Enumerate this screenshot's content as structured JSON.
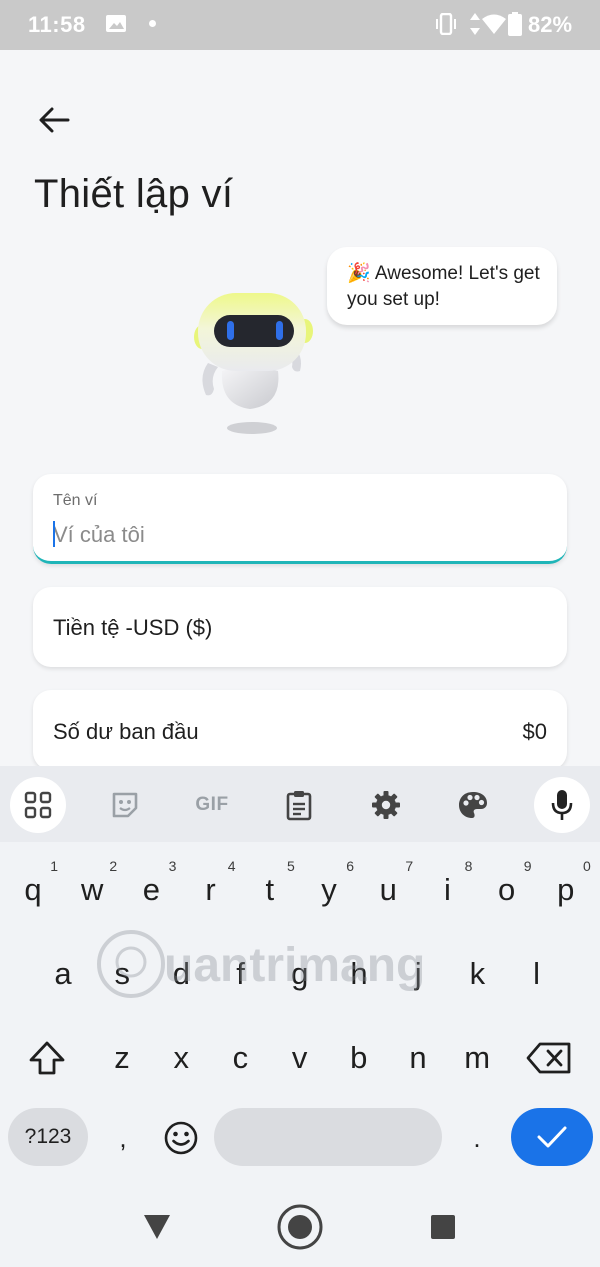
{
  "status_bar": {
    "time": "11:58",
    "battery": "82%",
    "icons": [
      "image-icon",
      "notification-dot",
      "vibrate-icon",
      "data-arrows-icon",
      "wifi-icon",
      "battery-icon"
    ]
  },
  "header": {
    "back_icon": "arrow-left-icon",
    "title": "Thiết lập ví"
  },
  "mascot": {
    "bubble_emoji": "🎉",
    "bubble_text": "Awesome! Let's get you set up!",
    "accent_color": "#e8f57a",
    "eye_color": "#2f6fe8"
  },
  "form": {
    "name_label": "Tên ví",
    "name_placeholder": "Ví của tôi",
    "name_value": "",
    "currency": "Tiền tệ -USD ($)",
    "balance_label": "Số dư ban đầu",
    "balance_value": "$0",
    "focus_color": "#1fb5b8"
  },
  "keyboard": {
    "toolbar": [
      "apps-grid-icon",
      "sticker-icon",
      "GIF",
      "clipboard-icon",
      "settings-gear-icon",
      "palette-icon",
      "microphone-icon"
    ],
    "gif_label": "GIF",
    "row1": [
      {
        "k": "q",
        "h": "1"
      },
      {
        "k": "w",
        "h": "2"
      },
      {
        "k": "e",
        "h": "3"
      },
      {
        "k": "r",
        "h": "4"
      },
      {
        "k": "t",
        "h": "5"
      },
      {
        "k": "y",
        "h": "6"
      },
      {
        "k": "u",
        "h": "7"
      },
      {
        "k": "i",
        "h": "8"
      },
      {
        "k": "o",
        "h": "9"
      },
      {
        "k": "p",
        "h": "0"
      }
    ],
    "row2": [
      "a",
      "s",
      "d",
      "f",
      "g",
      "h",
      "j",
      "k",
      "l"
    ],
    "row3": [
      "z",
      "x",
      "c",
      "v",
      "b",
      "n",
      "m"
    ],
    "symbols_label": "?123",
    "comma": ",",
    "period": ".",
    "enter_color": "#1a73e8"
  },
  "nav": [
    "back-triangle-icon",
    "home-circle-icon",
    "recents-square-icon"
  ],
  "watermark": "Quantrimang"
}
